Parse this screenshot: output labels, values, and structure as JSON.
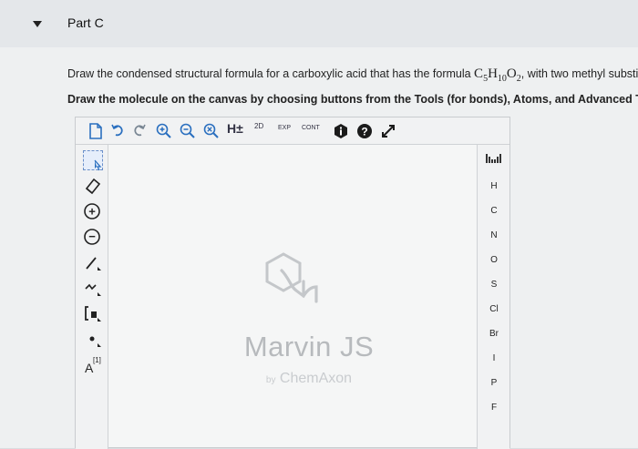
{
  "section": {
    "title": "Part C"
  },
  "question": {
    "line1_prefix": "Draw the condensed structural formula for a carboxylic acid that has the formula ",
    "formula_c": "C",
    "formula_c_sub": "5",
    "formula_h": "H",
    "formula_h_sub": "10",
    "formula_o": "O",
    "formula_o_sub": "2",
    "line1_suffix": ", with two methyl substituen",
    "line2": "Draw the molecule on the canvas by choosing buttons from the Tools (for bonds), Atoms, and Advanced Temp"
  },
  "toolbar": {
    "hydrogen_label": "H±",
    "d2_label": "2D",
    "exp_label": "EXP",
    "cont_label": "CONT"
  },
  "left_tools": {
    "charge_plus": "+",
    "charge_minus": "−",
    "atom_map_label": "A",
    "atom_map_index": "[1]"
  },
  "atoms": [
    "H",
    "C",
    "N",
    "O",
    "S",
    "Cl",
    "Br",
    "I",
    "P",
    "F"
  ],
  "watermark": {
    "product": "Marvin JS",
    "by": "by",
    "vendor": "ChemAxon"
  },
  "colors": {
    "accent": "#1a1a1a",
    "watermark": "#b7babd"
  }
}
